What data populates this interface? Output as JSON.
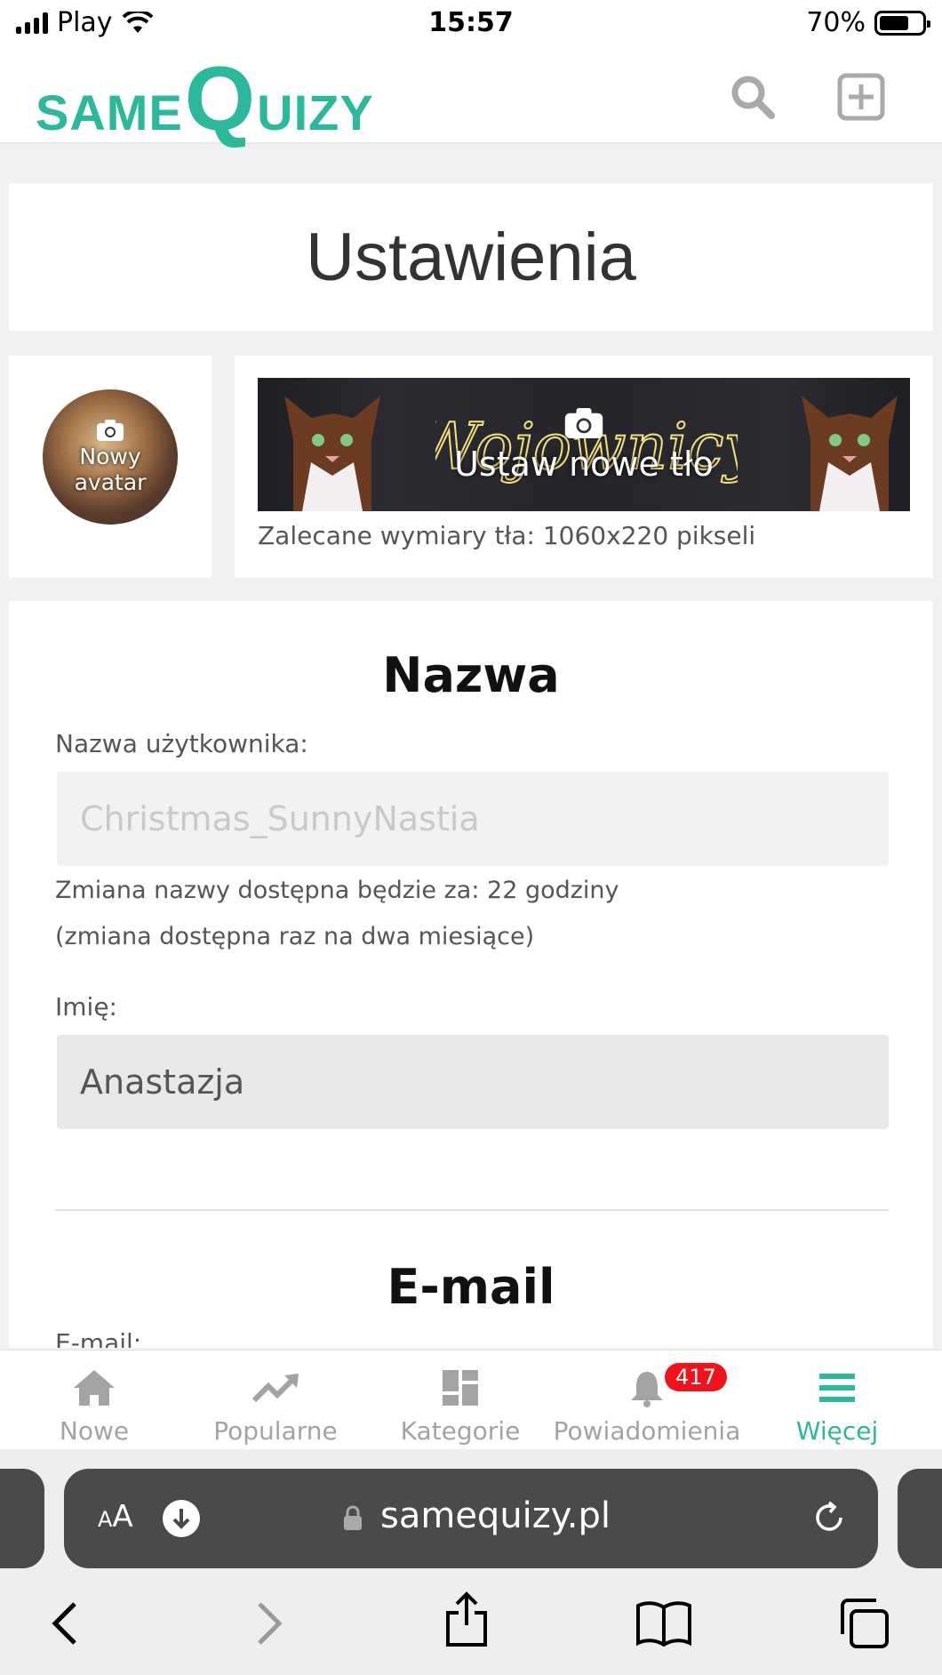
{
  "status_bar": {
    "carrier": "Play",
    "time": "15:57",
    "battery": "70%",
    "battery_level": 0.7
  },
  "header": {
    "logo_prefix": "SAME",
    "logo_q": "Q",
    "logo_suffix": "UIZY",
    "brand_color": "#2bb89b",
    "icons": [
      "search-icon",
      "add-box-icon"
    ]
  },
  "page": {
    "title": "Ustawienia"
  },
  "avatar": {
    "label": "Nowy avatar"
  },
  "background": {
    "banner_text": "Wojownicy",
    "set_label": "Ustaw nowe tło",
    "hint": "Zalecane wymiary tła: 1060x220 pikseli"
  },
  "name_section": {
    "title": "Nazwa",
    "username_label": "Nazwa użytkownika:",
    "username_value": "Christmas_SunnyNastia",
    "change_note": "Zmiana nazwy dostępna będzie za: 22 godziny",
    "change_frequency": "(zmiana dostępna raz na dwa miesiące)",
    "first_name_label": "Imię:",
    "first_name_value": "Anastazja"
  },
  "email_section": {
    "title": "E-mail",
    "email_label": "E-mail:"
  },
  "bottom_nav": {
    "items": [
      {
        "label": "Nowe",
        "icon": "home-icon"
      },
      {
        "label": "Popularne",
        "icon": "trending-icon"
      },
      {
        "label": "Kategorie",
        "icon": "dashboard-icon"
      },
      {
        "label": "Powiadomienia",
        "icon": "bell-icon",
        "badge": "417"
      },
      {
        "label": "Więcej",
        "icon": "menu-icon",
        "active": true
      }
    ],
    "active_color": "#2bb89b",
    "badge_color": "#f0131b"
  },
  "browser": {
    "aa_label": "AA",
    "url": "samequizy.pl",
    "toolbar_icons": [
      "back-icon",
      "forward-icon",
      "share-icon",
      "bookmarks-icon",
      "tabs-icon"
    ]
  }
}
